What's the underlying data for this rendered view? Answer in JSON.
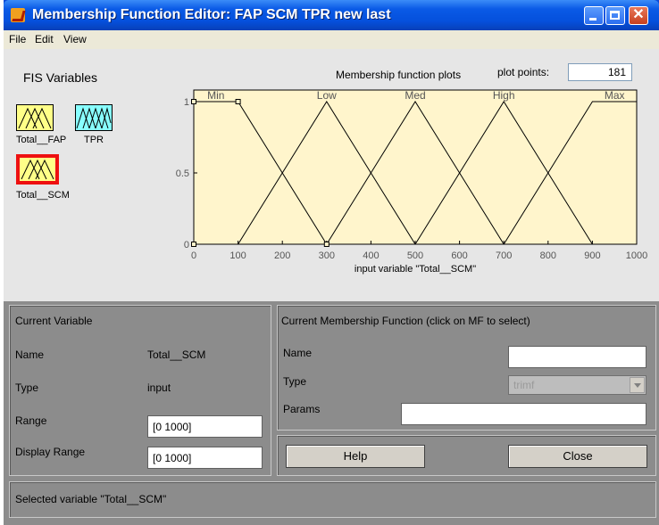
{
  "window": {
    "title": "Membership Function Editor: FAP SCM TPR new last"
  },
  "menu": [
    "File",
    "Edit",
    "View"
  ],
  "fis": {
    "label": "FIS Variables",
    "variables": [
      {
        "label": "Total__FAP",
        "color": "#ffff88",
        "selected": false
      },
      {
        "label": "TPR",
        "color": "#88ffff",
        "selected": false
      },
      {
        "label": "Total__SCM",
        "color": "#ffff88",
        "selected": true
      }
    ]
  },
  "plot": {
    "title": "Membership function plots",
    "plot_points_label": "plot points:",
    "plot_points_value": "181"
  },
  "chart_data": {
    "type": "line",
    "xlabel": "input variable \"Total__SCM\"",
    "xlim": [
      0,
      1000
    ],
    "ylim": [
      0,
      1
    ],
    "xticks": [
      0,
      100,
      200,
      300,
      400,
      500,
      600,
      700,
      800,
      900,
      1000
    ],
    "yticks": [
      0,
      0.5,
      1
    ],
    "background": "#fff5cc",
    "series": [
      {
        "name": "Min",
        "points": [
          [
            0,
            1
          ],
          [
            100,
            1
          ],
          [
            300,
            0
          ],
          [
            1000,
            0
          ]
        ],
        "label_x": 50
      },
      {
        "name": "Low",
        "points": [
          [
            0,
            0
          ],
          [
            100,
            0
          ],
          [
            300,
            1
          ],
          [
            500,
            0
          ],
          [
            1000,
            0
          ]
        ],
        "label_x": 300
      },
      {
        "name": "Med",
        "points": [
          [
            0,
            0
          ],
          [
            300,
            0
          ],
          [
            500,
            1
          ],
          [
            700,
            0
          ],
          [
            1000,
            0
          ]
        ],
        "label_x": 500
      },
      {
        "name": "High",
        "points": [
          [
            0,
            0
          ],
          [
            500,
            0
          ],
          [
            700,
            1
          ],
          [
            900,
            0
          ],
          [
            1000,
            0
          ]
        ],
        "label_x": 700
      },
      {
        "name": "Max",
        "points": [
          [
            0,
            0
          ],
          [
            700,
            0
          ],
          [
            900,
            1
          ],
          [
            1000,
            1
          ]
        ],
        "label_x": 950
      }
    ],
    "markers": [
      [
        0,
        1
      ],
      [
        100,
        1
      ],
      [
        0,
        0
      ],
      [
        300,
        0
      ]
    ]
  },
  "current_variable": {
    "header": "Current Variable",
    "name_label": "Name",
    "name_value": "Total__SCM",
    "type_label": "Type",
    "type_value": "input",
    "range_label": "Range",
    "range_value": "[0 1000]",
    "display_range_label": "Display Range",
    "display_range_value": "[0 1000]"
  },
  "current_mf": {
    "header": "Current Membership Function (click on MF to select)",
    "name_label": "Name",
    "name_value": "",
    "type_label": "Type",
    "type_value": "trimf",
    "params_label": "Params",
    "params_value": ""
  },
  "buttons": {
    "help": "Help",
    "close": "Close"
  },
  "status": "Selected variable \"Total__SCM\""
}
